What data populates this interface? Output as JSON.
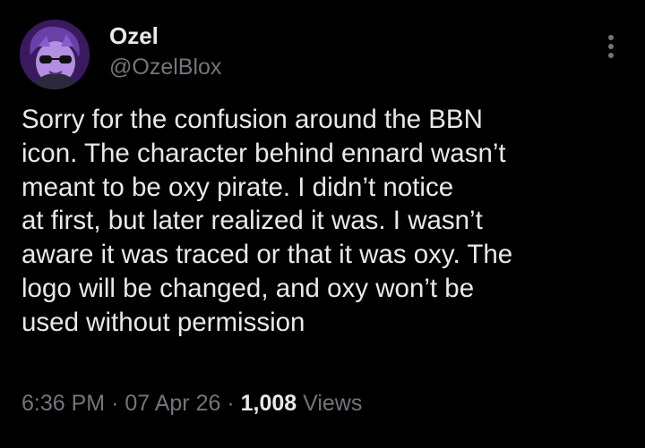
{
  "author": {
    "display_name": "Ozel",
    "handle": "@OzelBlox"
  },
  "tweet": {
    "text": "Sorry for the confusion around the BBN\nicon. The character behind ennard wasn’t\nmeant to be oxy pirate. I didn’t notice\nat first, but later realized it was. I wasn’t\naware it was traced or that it was oxy. The\nlogo will be changed, and oxy won’t be\nused without permission"
  },
  "meta": {
    "time": "6:36 PM",
    "separator": "·",
    "date": "07 Apr 26",
    "views_count": "1,008",
    "views_label": "Views"
  },
  "icons": {
    "more": "more-options-icon",
    "avatar": "avatar"
  },
  "colors": {
    "background": "#000000",
    "primary_text": "#e7e9ea",
    "secondary_text": "#71767b",
    "avatar_bg": "#3a1a5e"
  }
}
